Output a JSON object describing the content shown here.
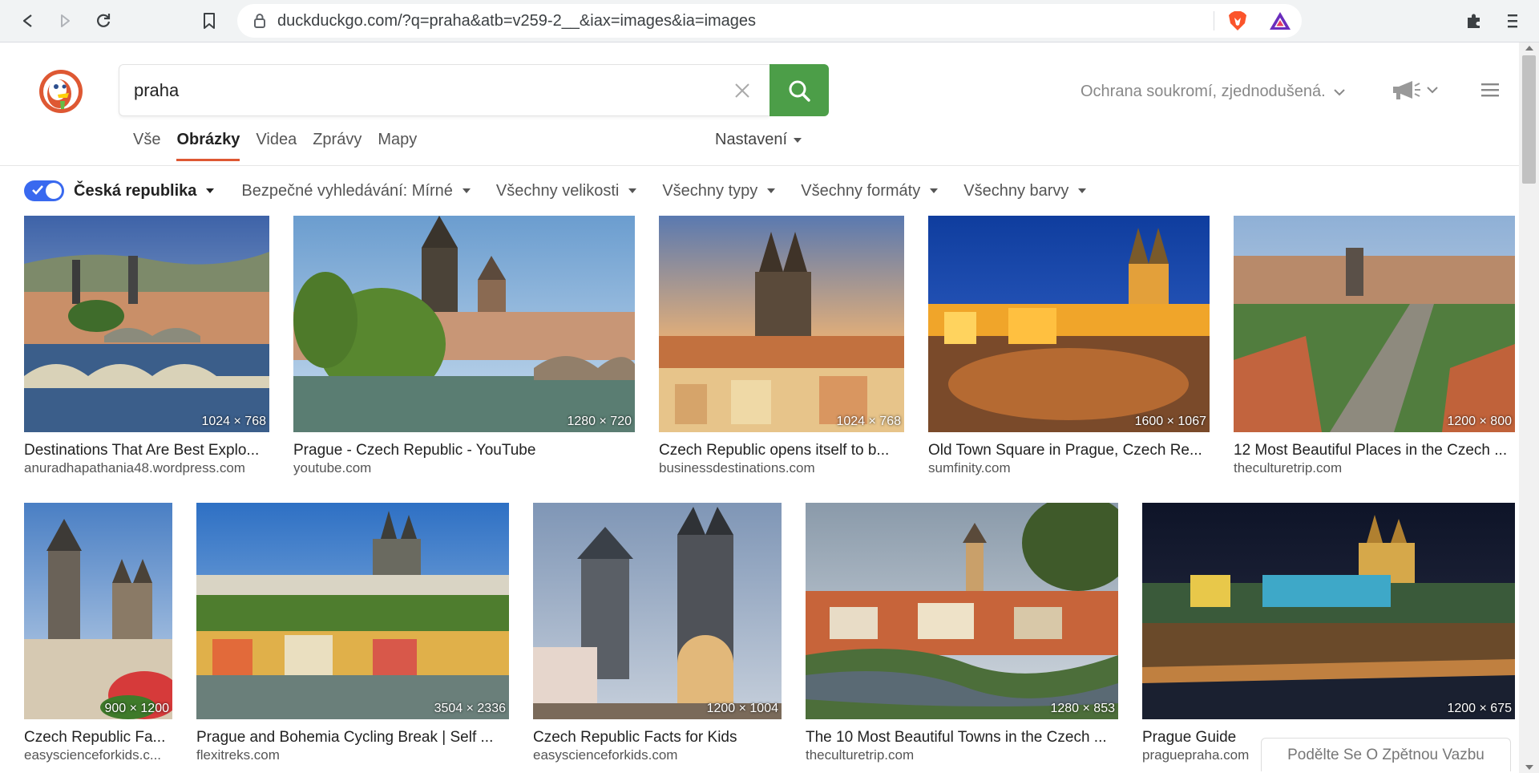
{
  "browser": {
    "url": "duckduckgo.com/?q=praha&atb=v259-2__&iax=images&ia=images"
  },
  "search": {
    "query": "praha",
    "privacy_label": "Ochrana soukromí, zjednodušená."
  },
  "nav": {
    "tabs": [
      {
        "label": "Vše"
      },
      {
        "label": "Obrázky",
        "active": true
      },
      {
        "label": "Videa"
      },
      {
        "label": "Zprávy"
      },
      {
        "label": "Mapy"
      }
    ],
    "settings_label": "Nastavení"
  },
  "filters": {
    "region": "Česká republika",
    "region_enabled": true,
    "items": [
      {
        "label": "Bezpečné vyhledávání: Mírné"
      },
      {
        "label": "Všechny velikosti"
      },
      {
        "label": "Všechny typy"
      },
      {
        "label": "Všechny formáty"
      },
      {
        "label": "Všechny barvy"
      }
    ]
  },
  "results": [
    {
      "title": "Destinations That Are Best Explo...",
      "source": "anuradhapathania48.wordpress.com",
      "dimensions": "1024 × 768"
    },
    {
      "title": "Prague - Czech Republic - YouTube",
      "source": "youtube.com",
      "dimensions": "1280 × 720"
    },
    {
      "title": "Czech Republic opens itself to b...",
      "source": "businessdestinations.com",
      "dimensions": "1024 × 768"
    },
    {
      "title": "Old Town Square in Prague, Czech Re...",
      "source": "sumfinity.com",
      "dimensions": "1600 × 1067"
    },
    {
      "title": "12 Most Beautiful Places in the Czech ...",
      "source": "theculturetrip.com",
      "dimensions": "1200 × 800"
    },
    {
      "title": "Czech Republic Fa...",
      "source": "easyscienceforkids.c...",
      "dimensions": "900 × 1200"
    },
    {
      "title": "Prague and Bohemia Cycling Break | Self ...",
      "source": "flexitreks.com",
      "dimensions": "3504 × 2336"
    },
    {
      "title": "Czech Republic Facts for Kids",
      "source": "easyscienceforkids.com",
      "dimensions": "1200 × 1004"
    },
    {
      "title": "The 10 Most Beautiful Towns in the Czech ...",
      "source": "theculturetrip.com",
      "dimensions": "1280 × 853"
    },
    {
      "title": "Prague Guide",
      "source": "praguepraha.com",
      "dimensions": "1200 × 675"
    }
  ],
  "feedback_label": "Podělte Se O Zpětnou Vazbu",
  "colors": {
    "accent_green": "#4c9e48",
    "active_tab_underline": "#de5833",
    "toggle_blue": "#3969ef"
  }
}
